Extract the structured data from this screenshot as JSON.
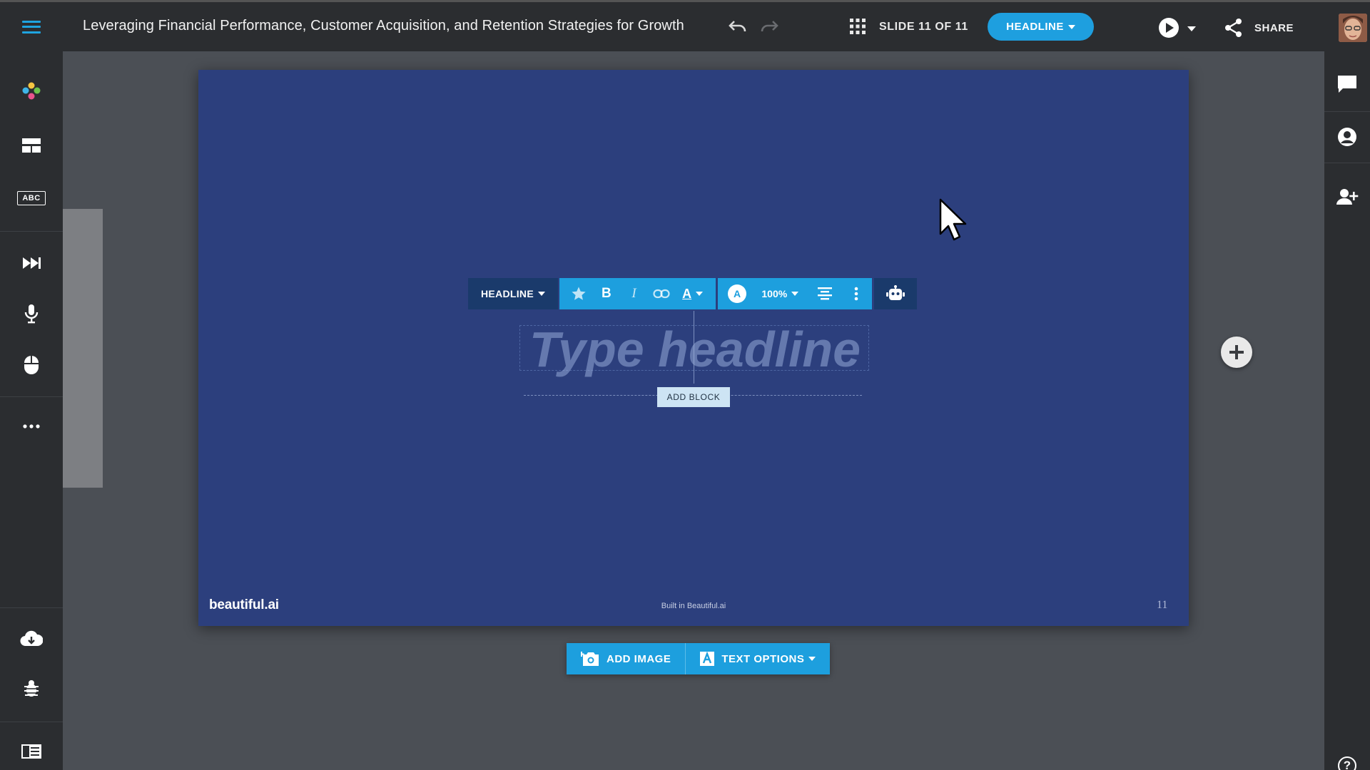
{
  "header": {
    "title": "Leveraging Financial Performance, Customer Acquisition, and Retention Strategies for Growth",
    "slide_counter": "SLIDE 11 OF 11",
    "layout_button": "HEADLINE",
    "share_label": "SHARE"
  },
  "colors": {
    "accent": "#1d9fde",
    "slide_background": "#2c3f7d",
    "chrome": "#2b2d30",
    "canvas": "#4b4f55"
  },
  "left_sidebar": {
    "items": [
      {
        "icon": "theme-palette-icon"
      },
      {
        "icon": "layout-icon"
      },
      {
        "icon": "abc-icon",
        "label": "ABC"
      },
      {
        "icon": "animation-icon"
      },
      {
        "icon": "microphone-icon"
      },
      {
        "icon": "mouse-icon"
      },
      {
        "icon": "more-icon"
      },
      {
        "icon": "cloud-download-icon"
      },
      {
        "icon": "bug-icon"
      },
      {
        "icon": "notes-icon"
      }
    ]
  },
  "right_sidebar": {
    "items": [
      {
        "icon": "comment-icon"
      },
      {
        "icon": "user-circle-icon"
      },
      {
        "icon": "add-user-icon"
      },
      {
        "icon": "help-icon",
        "label": "?"
      }
    ]
  },
  "toolbar": {
    "style_label": "HEADLINE",
    "bold": "B",
    "italic": "I",
    "text_color": "A",
    "color_swatch": "A",
    "zoom": "100%"
  },
  "slide": {
    "headline_placeholder": "Type headline",
    "add_block": "ADD BLOCK",
    "brand": "beautiful.ai",
    "built_in": "Built in Beautiful.ai",
    "page_number": "11"
  },
  "bottom_bar": {
    "add_image": "ADD IMAGE",
    "text_options": "TEXT OPTIONS"
  }
}
